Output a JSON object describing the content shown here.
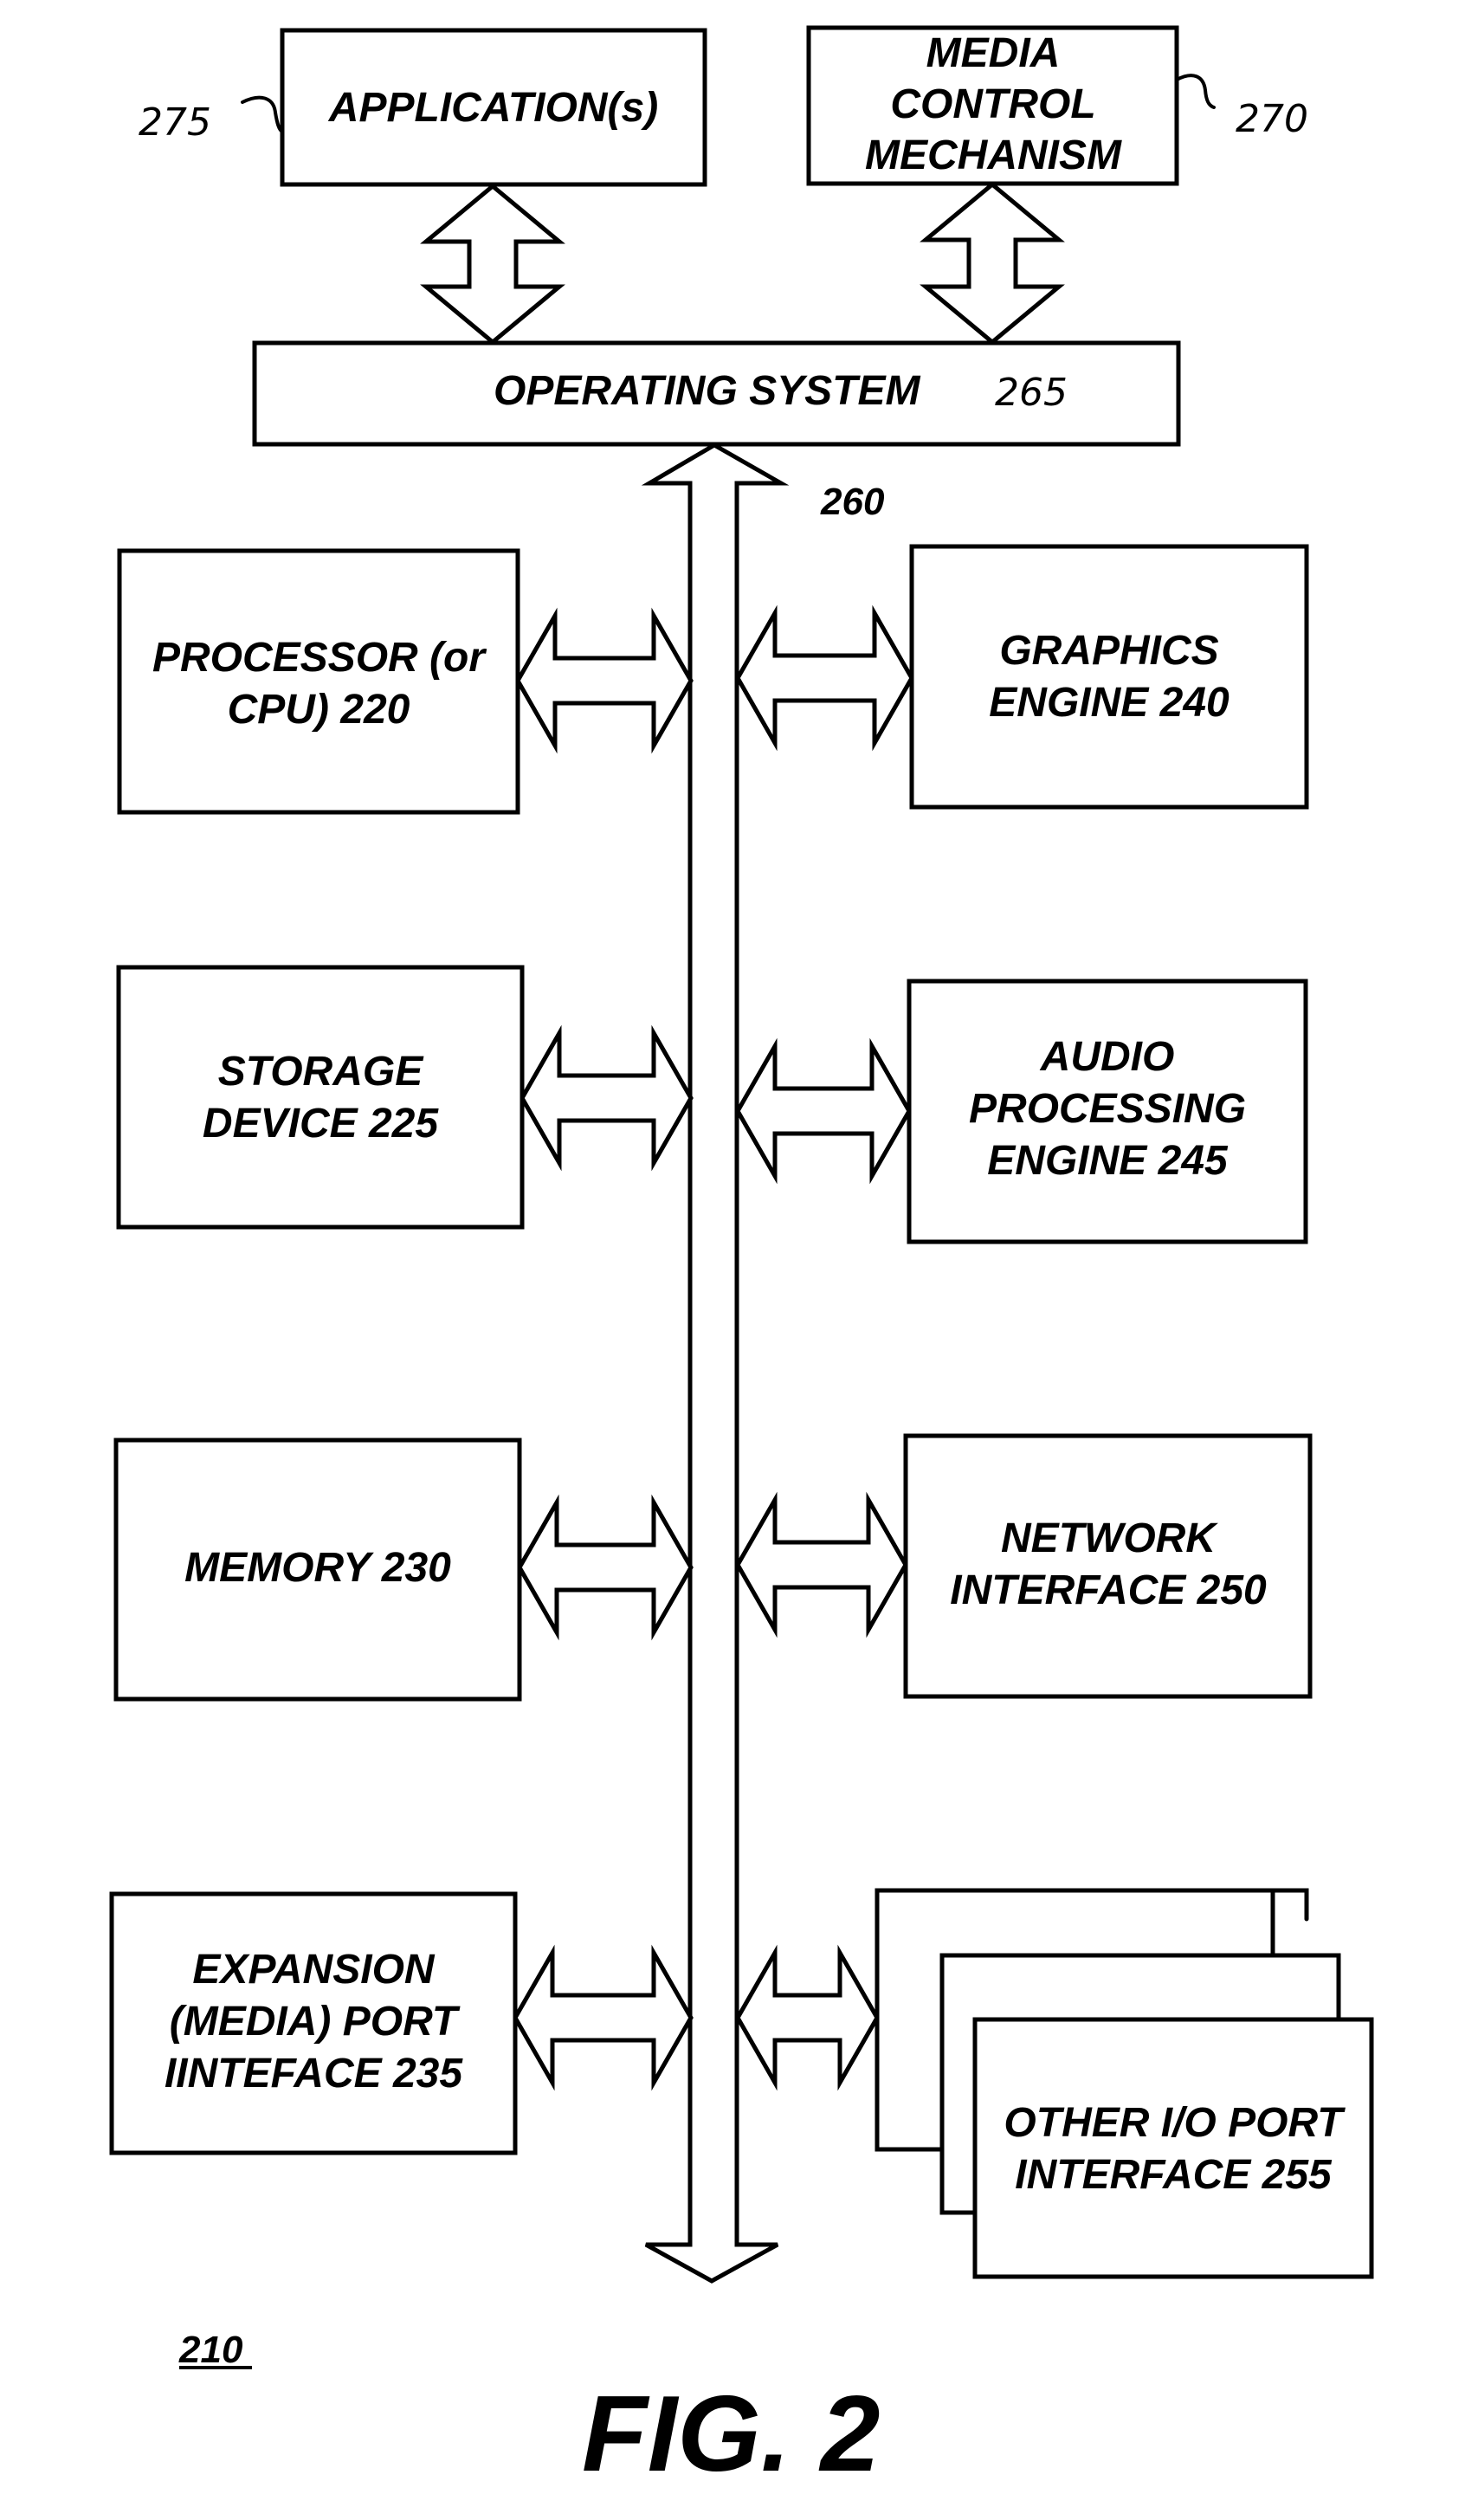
{
  "figure": {
    "caption": "FIG. 2",
    "system_ref": "210",
    "bus_ref": "260"
  },
  "components": {
    "applications": {
      "lines": [
        "APPLICATION(s)"
      ],
      "ref": "275"
    },
    "media_control": {
      "lines": [
        "MEDIA",
        "CONTROL",
        "MECHANISM"
      ],
      "ref": "270"
    },
    "operating_system": {
      "label": "OPERATING SYSTEM",
      "ref": "265"
    },
    "processor": {
      "lines": [
        "PROCESSOR (or",
        "CPU) 220"
      ]
    },
    "graphics": {
      "lines": [
        "GRAPHICS",
        "ENGINE 240"
      ]
    },
    "storage": {
      "lines": [
        "STORAGE",
        "DEVICE 225"
      ]
    },
    "audio": {
      "lines": [
        "AUDIO",
        "PROCESSING",
        "ENGINE 245"
      ]
    },
    "memory": {
      "lines": [
        "MEMORY 230"
      ]
    },
    "network": {
      "lines": [
        "NETWORK",
        "INTERFACE 250"
      ]
    },
    "expansion": {
      "lines": [
        "EXPANSION",
        "(MEDIA) PORT",
        "IINTEFACE 235"
      ]
    },
    "other_io": {
      "lines": [
        "OTHER I/O PORT",
        "INTERFACE 255"
      ]
    }
  },
  "connections": [
    {
      "from": "applications",
      "to": "operating_system",
      "type": "bidirectional"
    },
    {
      "from": "media_control",
      "to": "operating_system",
      "type": "bidirectional"
    },
    {
      "from": "operating_system",
      "to": "bus",
      "type": "bus"
    },
    {
      "from": "processor",
      "to": "bus",
      "type": "bidirectional"
    },
    {
      "from": "graphics",
      "to": "bus",
      "type": "bidirectional"
    },
    {
      "from": "storage",
      "to": "bus",
      "type": "bidirectional"
    },
    {
      "from": "audio",
      "to": "bus",
      "type": "bidirectional"
    },
    {
      "from": "memory",
      "to": "bus",
      "type": "bidirectional"
    },
    {
      "from": "network",
      "to": "bus",
      "type": "bidirectional"
    },
    {
      "from": "expansion",
      "to": "bus",
      "type": "bidirectional"
    },
    {
      "from": "other_io",
      "to": "bus",
      "type": "bidirectional"
    }
  ]
}
